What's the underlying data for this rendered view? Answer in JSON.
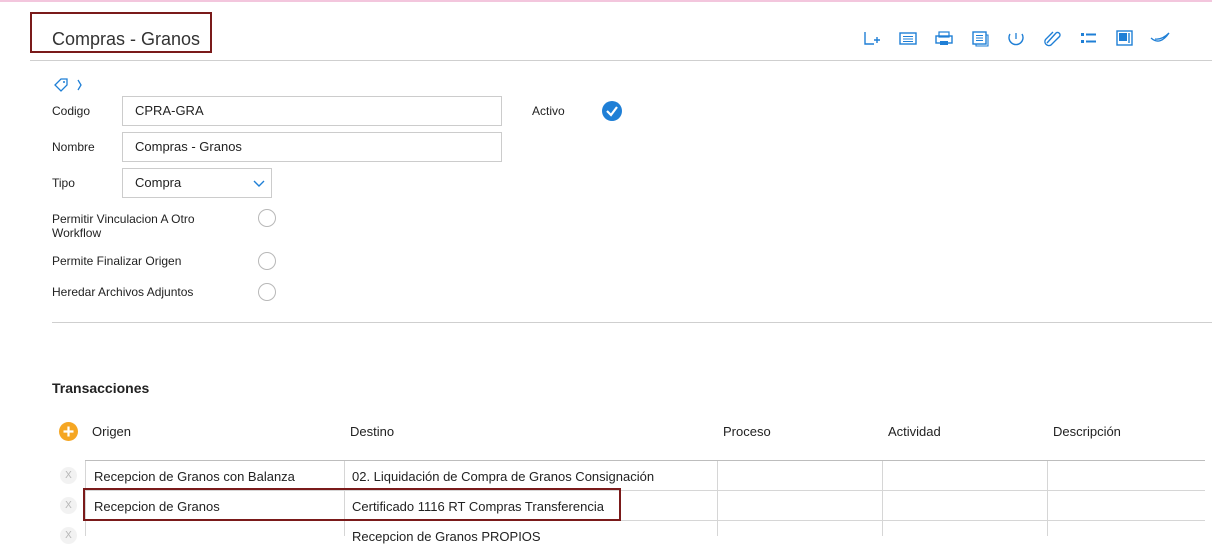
{
  "header": {
    "title": "Compras - Granos",
    "toolbar_icons": [
      "new-icon",
      "list-icon",
      "print-icon",
      "document-icon",
      "history-icon",
      "attach-icon",
      "bullet-list-icon",
      "save-icon",
      "comment-icon"
    ]
  },
  "form": {
    "codigo_label": "Codigo",
    "codigo_value": "CPRA-GRA",
    "activo_label": "Activo",
    "activo_checked": true,
    "nombre_label": "Nombre",
    "nombre_value": "Compras - Granos",
    "tipo_label": "Tipo",
    "tipo_value": "Compra",
    "vinculacion_label_1": "Permitir Vinculacion A Otro",
    "vinculacion_label_2": "Workflow",
    "finalizar_label": "Permite Finalizar Origen",
    "heredar_label": "Heredar Archivos Adjuntos"
  },
  "transacciones": {
    "title": "Transacciones",
    "columns": [
      "Origen",
      "Destino",
      "Proceso",
      "Actividad",
      "Descripción"
    ],
    "rows": [
      {
        "origen": "Recepcion de Granos con Balanza",
        "destino": "02. Liquidación de Compra de Granos Consignación",
        "proceso": "",
        "actividad": "",
        "descripcion": ""
      },
      {
        "origen": "Recepcion de Granos",
        "destino": "Certificado 1116 RT Compras Transferencia",
        "proceso": "",
        "actividad": "",
        "descripcion": ""
      },
      {
        "origen": "",
        "destino": "Recepcion de Granos PROPIOS",
        "proceso": "",
        "actividad": "",
        "descripcion": ""
      }
    ],
    "delete_glyph": "X"
  },
  "colors": {
    "accent_blue": "#1f7fd6",
    "highlight_border": "#7a1a1a",
    "add_button": "#f5a623"
  }
}
